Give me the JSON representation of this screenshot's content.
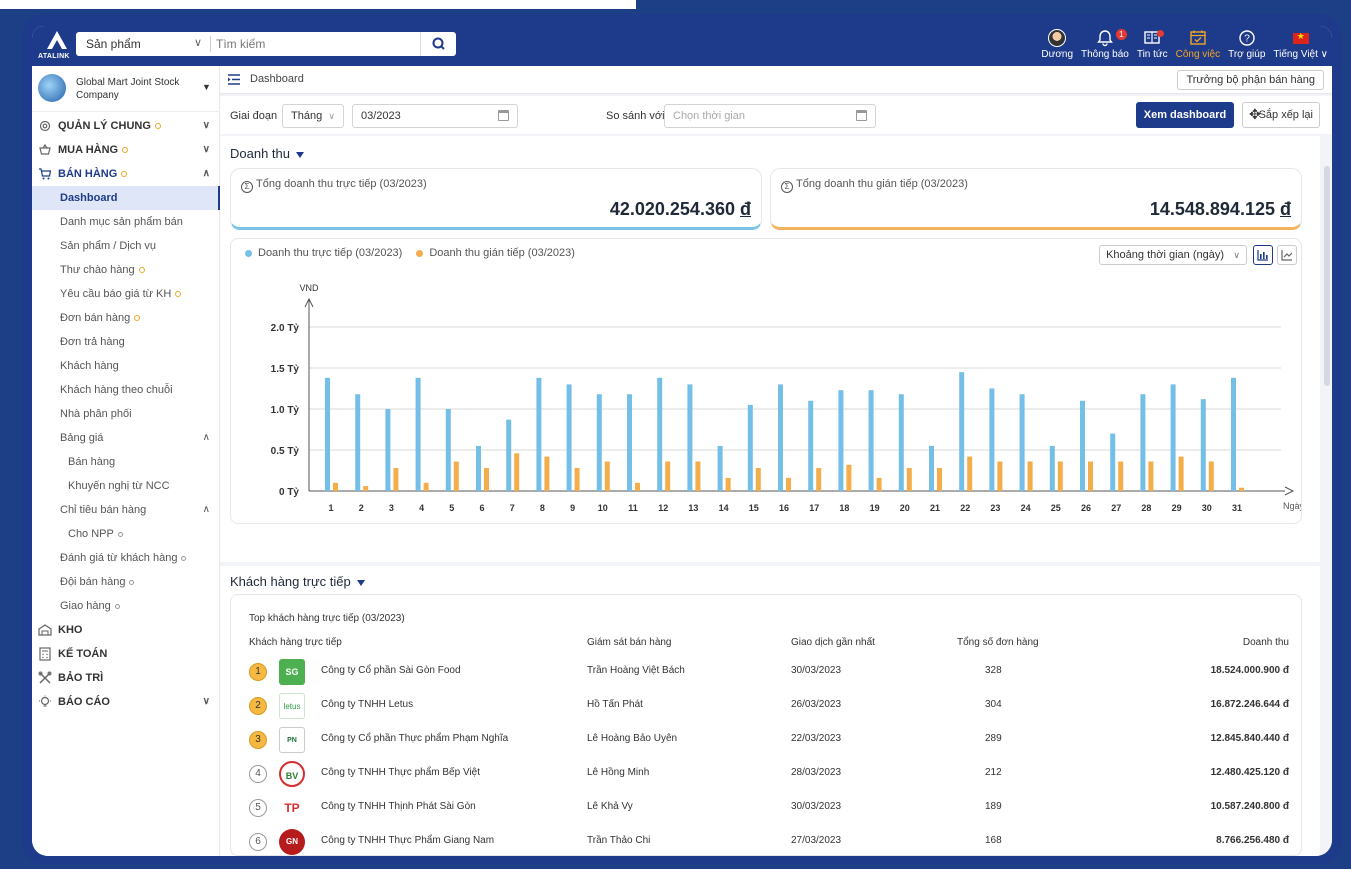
{
  "app": {
    "logo_text": "ATALINK"
  },
  "search": {
    "scope": "Sản phẩm",
    "placeholder": "Tìm kiếm"
  },
  "header": {
    "user": "Dương",
    "notifications": {
      "label": "Thông báo",
      "count": "1"
    },
    "news": "Tin tức",
    "work": "Công việc",
    "help": "Trợ giúp",
    "language": "Tiếng Việt"
  },
  "company": {
    "name": "Global Mart Joint Stock Company"
  },
  "sidebar": {
    "items": [
      {
        "label": "QUẢN LÝ CHUNG"
      },
      {
        "label": "MUA HÀNG"
      },
      {
        "label": "BÁN HÀNG"
      },
      {
        "label": "Dashboard"
      },
      {
        "label": "Danh mục sản phẩm bán"
      },
      {
        "label": "Sản phẩm / Dịch vụ"
      },
      {
        "label": "Thư chào hàng"
      },
      {
        "label": "Yêu cầu báo giá từ KH"
      },
      {
        "label": "Đơn bán hàng"
      },
      {
        "label": "Đơn trả hàng"
      },
      {
        "label": "Khách hàng"
      },
      {
        "label": "Khách hàng theo chuỗi"
      },
      {
        "label": "Nhà phân phối"
      },
      {
        "label": "Bảng giá"
      },
      {
        "label": "Bán hàng"
      },
      {
        "label": "Khuyến nghị từ NCC"
      },
      {
        "label": "Chỉ tiêu bán hàng"
      },
      {
        "label": "Cho NPP"
      },
      {
        "label": "Đánh giá từ khách hàng"
      },
      {
        "label": "Đội bán hàng"
      },
      {
        "label": "Giao hàng"
      },
      {
        "label": "KHO"
      },
      {
        "label": "KẾ TOÁN"
      },
      {
        "label": "BẢO TRÌ"
      },
      {
        "label": "BÁO CÁO"
      }
    ]
  },
  "breadcrumb": {
    "title": "Dashboard",
    "role": "Trưởng bộ phận bán hàng"
  },
  "filter": {
    "period_label": "Giai đoạn",
    "period_unit": "Tháng",
    "period_value": "03/2023",
    "compare_label": "So sánh với",
    "compare_placeholder": "Chọn thời gian",
    "view_button": "Xem dashboard",
    "rearrange_button": "Sắp xếp lại"
  },
  "revenue": {
    "section_title": "Doanh thu",
    "direct_label": "Tổng doanh thu trực tiếp (03/2023)",
    "direct_value": "42.020.254.360",
    "indirect_label": "Tổng doanh thu gián tiếp (03/2023)",
    "indirect_value": "14.548.894.125",
    "currency": "đ",
    "range_select": "Khoảng thời gian (ngày)"
  },
  "chart_data": {
    "type": "bar",
    "ylabel": "VND",
    "xlabel": "Ngày",
    "yticks": [
      "0 Tỷ",
      "0.5 Tỷ",
      "1.0 Tỷ",
      "1.5 Tỷ",
      "2.0 Tỷ"
    ],
    "ylim": [
      0,
      2.0
    ],
    "categories": [
      "1",
      "2",
      "3",
      "4",
      "5",
      "6",
      "7",
      "8",
      "9",
      "10",
      "11",
      "12",
      "13",
      "14",
      "15",
      "16",
      "17",
      "18",
      "19",
      "20",
      "21",
      "22",
      "23",
      "24",
      "25",
      "26",
      "27",
      "28",
      "29",
      "30",
      "31"
    ],
    "series": [
      {
        "name": "Doanh thu trực tiếp (03/2023)",
        "color": "#74bfe8",
        "values": [
          1.38,
          1.18,
          1.0,
          1.38,
          1.0,
          0.55,
          0.87,
          1.38,
          1.3,
          1.18,
          1.18,
          1.38,
          1.3,
          0.55,
          1.05,
          1.3,
          1.1,
          1.23,
          1.23,
          1.18,
          0.55,
          1.45,
          1.25,
          1.18,
          0.55,
          1.1,
          0.7,
          1.18,
          1.3,
          1.12,
          1.38
        ]
      },
      {
        "name": "Doanh thu gián tiếp (03/2023)",
        "color": "#f3ae4b",
        "values": [
          0.1,
          0.06,
          0.28,
          0.1,
          0.36,
          0.28,
          0.46,
          0.42,
          0.28,
          0.36,
          0.1,
          0.36,
          0.36,
          0.16,
          0.28,
          0.16,
          0.28,
          0.32,
          0.16,
          0.28,
          0.28,
          0.42,
          0.36,
          0.36,
          0.36,
          0.36,
          0.36,
          0.36,
          0.42,
          0.36,
          0.04
        ]
      }
    ],
    "grid": true,
    "legend": "top-left"
  },
  "customers": {
    "section_title": "Khách hàng trực tiếp",
    "table_title": "Top khách hàng trực tiếp (03/2023)",
    "headers": [
      "Khách hàng trực tiếp",
      "Giám sát bán hàng",
      "Giao dịch gần nhất",
      "Tổng số đơn hàng",
      "Doanh thu"
    ],
    "rows": [
      {
        "rank": "1",
        "logo": "SG",
        "name": "Công ty Cổ phần Sài Gòn Food",
        "supervisor": "Trần Hoàng Việt Bách",
        "last": "30/03/2023",
        "orders": "328",
        "revenue": "18.524.000.900 đ"
      },
      {
        "rank": "2",
        "logo": "letus",
        "name": "Công ty TNHH Letus",
        "supervisor": "Hồ Tấn Phát",
        "last": "26/03/2023",
        "orders": "304",
        "revenue": "16.872.246.644 đ"
      },
      {
        "rank": "3",
        "logo": "PN",
        "name": "Công ty Cổ phần Thực phẩm Phạm Nghĩa",
        "supervisor": "Lê Hoàng Bảo Uyên",
        "last": "22/03/2023",
        "orders": "289",
        "revenue": "12.845.840.440 đ"
      },
      {
        "rank": "4",
        "logo": "BV",
        "name": "Công ty TNHH Thực phẩm Bếp Việt",
        "supervisor": "Lê Hồng Minh",
        "last": "28/03/2023",
        "orders": "212",
        "revenue": "12.480.425.120 đ"
      },
      {
        "rank": "5",
        "logo": "TP",
        "name": "Công ty TNHH Thịnh Phát Sài Gòn",
        "supervisor": "Lê Khả Vy",
        "last": "30/03/2023",
        "orders": "189",
        "revenue": "10.587.240.800 đ"
      },
      {
        "rank": "6",
        "logo": "GN",
        "name": "Công ty TNHH Thực Phẩm Giang Nam",
        "supervisor": "Trần Thảo Chi",
        "last": "27/03/2023",
        "orders": "168",
        "revenue": "8.766.256.480 đ"
      }
    ]
  }
}
